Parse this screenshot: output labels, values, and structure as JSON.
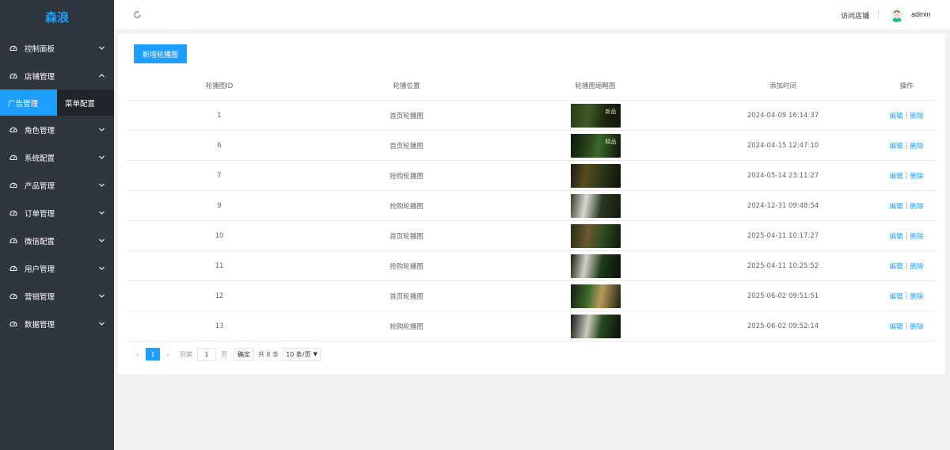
{
  "sidebar": {
    "logo": "森浪",
    "items": [
      {
        "label": "控制面板",
        "icon": "dashboard-icon",
        "expanded": false
      },
      {
        "label": "店铺管理",
        "icon": "dashboard-icon",
        "expanded": true
      },
      {
        "label": "角色管理",
        "icon": "dashboard-icon",
        "expanded": false
      },
      {
        "label": "系统配置",
        "icon": "dashboard-icon",
        "expanded": false
      },
      {
        "label": "产品管理",
        "icon": "dashboard-icon",
        "expanded": false
      },
      {
        "label": "订单管理",
        "icon": "dashboard-icon",
        "expanded": false
      },
      {
        "label": "微信配置",
        "icon": "dashboard-icon",
        "expanded": false
      },
      {
        "label": "用户管理",
        "icon": "dashboard-icon",
        "expanded": false
      },
      {
        "label": "营销管理",
        "icon": "dashboard-icon",
        "expanded": false
      },
      {
        "label": "数据管理",
        "icon": "dashboard-icon",
        "expanded": false
      }
    ],
    "subitems": [
      {
        "label": "广告管理",
        "active": true
      },
      {
        "label": "菜单配置",
        "active": false
      }
    ]
  },
  "header": {
    "refresh_icon": "refresh-icon",
    "visit_store": "访问店铺",
    "username": "admin"
  },
  "main": {
    "add_button": "新增轮播图",
    "columns": [
      "轮播图ID",
      "轮播位置",
      "轮播图缩略图",
      "添加时间",
      "操作"
    ],
    "rows": [
      {
        "id": "1",
        "position": "首页轮播图",
        "thumb_text": "新品",
        "time": "2024-04-09 16:14:37"
      },
      {
        "id": "6",
        "position": "首页轮播图",
        "thumb_text": "精品",
        "time": "2024-04-15 12:47:10"
      },
      {
        "id": "7",
        "position": "抢购轮播图",
        "thumb_text": "",
        "time": "2024-05-14 23:11:27"
      },
      {
        "id": "9",
        "position": "抢购轮播图",
        "thumb_text": "",
        "time": "2024-12-31 09:48:54"
      },
      {
        "id": "10",
        "position": "首页轮播图",
        "thumb_text": "",
        "time": "2025-04-11 10:17:27"
      },
      {
        "id": "11",
        "position": "抢购轮播图",
        "thumb_text": "",
        "time": "2025-04-11 10:25:52"
      },
      {
        "id": "12",
        "position": "首页轮播图",
        "thumb_text": "",
        "time": "2025-06-02 09:51:51"
      },
      {
        "id": "13",
        "position": "抢购轮播图",
        "thumb_text": "",
        "time": "2025-06-02 09:52:14"
      }
    ],
    "action_edit": "编辑",
    "action_sep": "|",
    "action_delete": "删除"
  },
  "pagination": {
    "prev": "‹",
    "current": "1",
    "next": "›",
    "goto_label": "到第",
    "goto_value": "1",
    "page_label": "页",
    "confirm": "确定",
    "total": "共 8 条",
    "page_size": "10 条/页"
  },
  "colors": {
    "accent": "#1e9fff",
    "sidebar_bg": "#2f3640",
    "submenu_bg": "#1f252b",
    "page_bg": "#f2f2f2"
  }
}
